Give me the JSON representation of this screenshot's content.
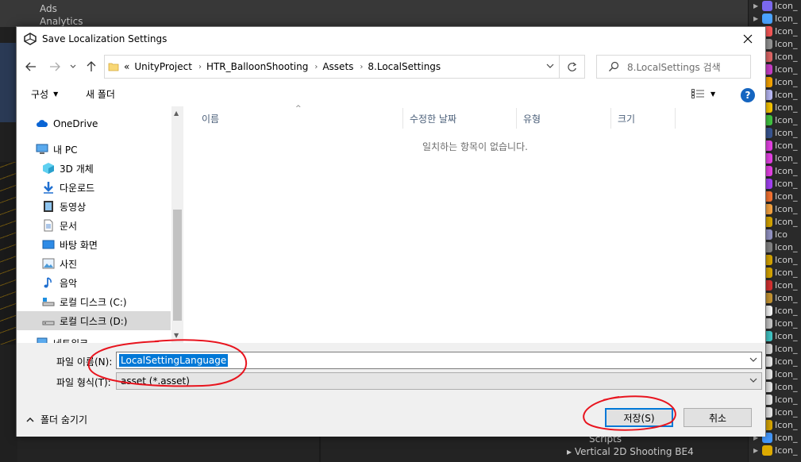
{
  "unity_bg": {
    "top_items": [
      "Ads",
      "Analytics"
    ],
    "bottom_items": [
      "Scripts",
      "Vertical 2D Shooting BE4"
    ],
    "right_items": [
      {
        "label": "Icon_",
        "color": "#7b68ee"
      },
      {
        "label": "Icon_",
        "color": "#4aa3ff"
      },
      {
        "label": "Icon_",
        "color": "#ff5a5a"
      },
      {
        "label": "Icon_",
        "color": "#999999"
      },
      {
        "label": "Icon_",
        "color": "#e86a6a"
      },
      {
        "label": "Icon_",
        "color": "#d040d0"
      },
      {
        "label": "Icon_",
        "color": "#ffaa00"
      },
      {
        "label": "Icon_",
        "color": "#c0c0ff"
      },
      {
        "label": "Icon_",
        "color": "#ffcc00"
      },
      {
        "label": "Icon_",
        "color": "#44cc44"
      },
      {
        "label": "Icon_",
        "color": "#3b5998"
      },
      {
        "label": "Icon_",
        "color": "#ee44ee"
      },
      {
        "label": "Icon_",
        "color": "#ee44ee"
      },
      {
        "label": "Icon_",
        "color": "#ee44ee"
      },
      {
        "label": "Icon_",
        "color": "#aa44ff"
      },
      {
        "label": "Icon_",
        "color": "#ff7733"
      },
      {
        "label": "Icon_",
        "color": "#ffaa44"
      },
      {
        "label": "Icon_",
        "color": "#ddaa00"
      },
      {
        "label": "Ico",
        "color": "#9999cc"
      },
      {
        "label": "Icon_",
        "color": "#888888"
      },
      {
        "label": "Icon_",
        "color": "#ddaa00"
      },
      {
        "label": "Icon_",
        "color": "#ddaa00"
      },
      {
        "label": "Icon_",
        "color": "#dd3333"
      },
      {
        "label": "Icon_",
        "color": "#cc9933"
      },
      {
        "label": "Icon_",
        "color": "#ffffff"
      },
      {
        "label": "Icon_",
        "color": "#cccccc"
      },
      {
        "label": "Icon_",
        "color": "#44cccc"
      },
      {
        "label": "Icon_",
        "color": "#dddddd"
      },
      {
        "label": "Icon_",
        "color": "#eeeeee"
      },
      {
        "label": "Icon_",
        "color": "#eeeeee"
      },
      {
        "label": "Icon_",
        "color": "#eeeeee"
      },
      {
        "label": "Icon_",
        "color": "#eeeeee"
      },
      {
        "label": "Icon_",
        "color": "#eeeeee"
      },
      {
        "label": "Icon_",
        "color": "#ddaa00"
      },
      {
        "label": "Icon_",
        "color": "#4499ff"
      },
      {
        "label": "Icon_",
        "color": "#ddaa00"
      }
    ]
  },
  "dialog": {
    "title": "Save Localization Settings",
    "address": {
      "prefix": "«",
      "segments": [
        "UnityProject",
        "HTR_BalloonShooting",
        "Assets",
        "8.LocalSettings"
      ]
    },
    "search_placeholder": "8.LocalSettings 검색",
    "toolbar": {
      "organize": "구성",
      "new_folder": "새 폴더"
    },
    "nav_items": [
      {
        "label": "OneDrive",
        "icon": "cloud-icon"
      },
      {
        "label": "내 PC",
        "icon": "computer-icon"
      },
      {
        "label": "3D 개체",
        "icon": "cube-icon"
      },
      {
        "label": "다운로드",
        "icon": "download-icon"
      },
      {
        "label": "동영상",
        "icon": "video-icon"
      },
      {
        "label": "문서",
        "icon": "document-icon"
      },
      {
        "label": "바탕 화면",
        "icon": "desktop-icon"
      },
      {
        "label": "사진",
        "icon": "picture-icon"
      },
      {
        "label": "음악",
        "icon": "music-icon"
      },
      {
        "label": "로컬 디스크 (C:)",
        "icon": "drive-icon"
      },
      {
        "label": "로컬 디스크 (D:)",
        "icon": "drive-icon"
      },
      {
        "label": "네트워크",
        "icon": "network-icon"
      }
    ],
    "columns": [
      "이름",
      "수정한 날짜",
      "유형",
      "크기"
    ],
    "empty_message": "일치하는 항목이 없습니다.",
    "filename_label": "파일 이름(N):",
    "filename_value": "LocalSettingLanguage",
    "filetype_label": "파일 형식(T):",
    "filetype_value": "asset (*.asset)",
    "hide_folders": "폴더 숨기기",
    "save_button": "저장(S)",
    "cancel_button": "취소"
  },
  "colors": {
    "accent": "#0078d7",
    "annotation": "#e8141e"
  }
}
